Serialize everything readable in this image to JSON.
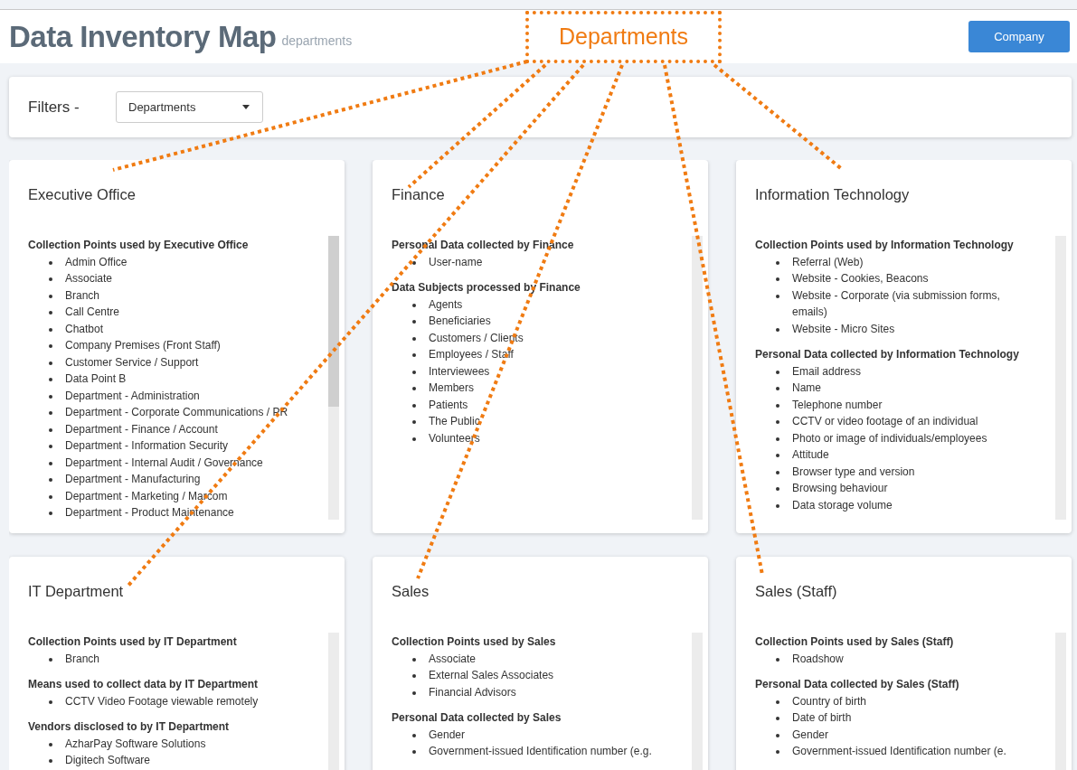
{
  "header": {
    "title": "Data Inventory Map",
    "subtitle": "departments",
    "button": "Company"
  },
  "annotation": {
    "label": "Departments"
  },
  "filters": {
    "label": "Filters -",
    "dropdown": "Departments"
  },
  "departments": [
    {
      "name": "Executive Office",
      "sections": [
        {
          "heading": "Collection Points used by Executive Office",
          "items": [
            "Admin Office",
            "Associate",
            "Branch",
            "Call Centre",
            "Chatbot",
            "Company Premises (Front Staff)",
            "Customer Service / Support",
            "Data Point B",
            "Department - Administration",
            "Department - Corporate Communications / PR",
            "Department - Finance / Account",
            "Department - Information Security",
            "Department - Internal Audit / Governance",
            "Department - Manufacturing",
            "Department - Marketing / Marcom",
            "Department - Product Maintenance"
          ]
        }
      ]
    },
    {
      "name": "Finance",
      "sections": [
        {
          "heading": "Personal Data collected by Finance",
          "items": [
            "User-name"
          ]
        },
        {
          "heading": "Data Subjects processed by Finance",
          "items": [
            "Agents",
            "Beneficiaries",
            "Customers / Clients",
            "Employees / Staff",
            "Interviewees",
            "Members",
            "Patients",
            "The Public",
            "Volunteers"
          ]
        }
      ]
    },
    {
      "name": "Information Technology",
      "sections": [
        {
          "heading": "Collection Points used by Information Technology",
          "items": [
            "Referral (Web)",
            "Website - Cookies, Beacons",
            "Website - Corporate (via submission forms, emails)",
            "Website - Micro Sites"
          ]
        },
        {
          "heading": "Personal Data collected by Information Technology",
          "items": [
            "Email address",
            "Name",
            "Telephone number",
            "CCTV or video footage of an individual",
            "Photo or image of individuals/employees",
            "Attitude",
            "Browser type and version",
            "Browsing behaviour",
            "Data storage volume"
          ]
        }
      ]
    },
    {
      "name": "IT Department",
      "sections": [
        {
          "heading": "Collection Points used by IT Department",
          "items": [
            "Branch"
          ]
        },
        {
          "heading": "Means used to collect data by IT Department",
          "items": [
            "CCTV Video Footage viewable remotely"
          ]
        },
        {
          "heading": "Vendors disclosed to by IT Department",
          "items": [
            "AzharPay Software Solutions",
            "Digitech Software"
          ]
        }
      ]
    },
    {
      "name": "Sales",
      "sections": [
        {
          "heading": "Collection Points used by Sales",
          "items": [
            "Associate",
            "External Sales Associates",
            "Financial Advisors"
          ]
        },
        {
          "heading": "Personal Data collected by Sales",
          "items": [
            "Gender",
            "Government-issued Identification number (e.g."
          ]
        }
      ]
    },
    {
      "name": "Sales (Staff)",
      "sections": [
        {
          "heading": "Collection Points used by Sales (Staff)",
          "items": [
            "Roadshow"
          ]
        },
        {
          "heading": "Personal Data collected by Sales (Staff)",
          "items": [
            "Country of birth",
            "Date of birth",
            "Gender",
            "Government-issued Identification number (e."
          ]
        }
      ]
    }
  ]
}
